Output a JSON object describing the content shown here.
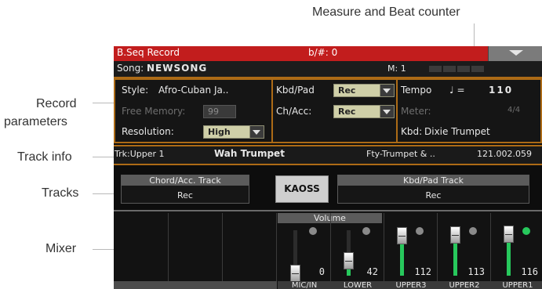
{
  "callouts": {
    "measure_beat": "Measure and Beat counter",
    "record_params_1": "Record",
    "record_params_2": "parameters",
    "track_info": "Track info",
    "tracks": "Tracks",
    "mixer": "Mixer"
  },
  "titlebar": {
    "title": "B.Seq Record",
    "key_sig": "b/#: 0"
  },
  "song": {
    "label": "Song:",
    "name": "NEWSONG",
    "measure": "M: 1"
  },
  "params": {
    "style_label": "Style:",
    "style_value": "Afro-Cuban Ja..",
    "free_memory_label": "Free Memory:",
    "free_memory_value": "99",
    "resolution_label": "Resolution:",
    "resolution_value": "High",
    "kbdpad_label": "Kbd/Pad",
    "kbdpad_value": "Rec",
    "chacc_label": "Ch/Acc:",
    "chacc_value": "Rec",
    "tempo_label": "Tempo",
    "tempo_note": "♩ =",
    "tempo_value": "110",
    "meter_label": "Meter:",
    "meter_value": "4/4",
    "kbd_label": "Kbd:",
    "kbd_value": "Dixie Trumpet"
  },
  "track_info": {
    "track": "Trk:Upper 1",
    "sound": "Wah Trumpet",
    "category": "Fty-Trumpet & ..",
    "program": "121.002.059"
  },
  "tracks": {
    "chord_header": "Chord/Acc. Track",
    "chord_value": "Rec",
    "kaoss": "KAOSS",
    "kbdpad_header": "Kbd/Pad Track",
    "kbdpad_value": "Rec"
  },
  "mixer": {
    "volume_label": "Volume",
    "strips": [
      {
        "name": "MIC/IN",
        "value": "0",
        "level": 0.0
      },
      {
        "name": "LOWER",
        "value": "42",
        "level": 0.33
      },
      {
        "name": "UPPER3",
        "value": "112",
        "level": 0.88
      },
      {
        "name": "UPPER2",
        "value": "113",
        "level": 0.89
      },
      {
        "name": "UPPER1",
        "value": "116",
        "level": 0.91
      }
    ]
  },
  "colors": {
    "title_red": "#c21d1d",
    "accent_orange": "#ad6b16",
    "meter_green": "#27c85c",
    "field_bg": "#cfcfa8"
  }
}
